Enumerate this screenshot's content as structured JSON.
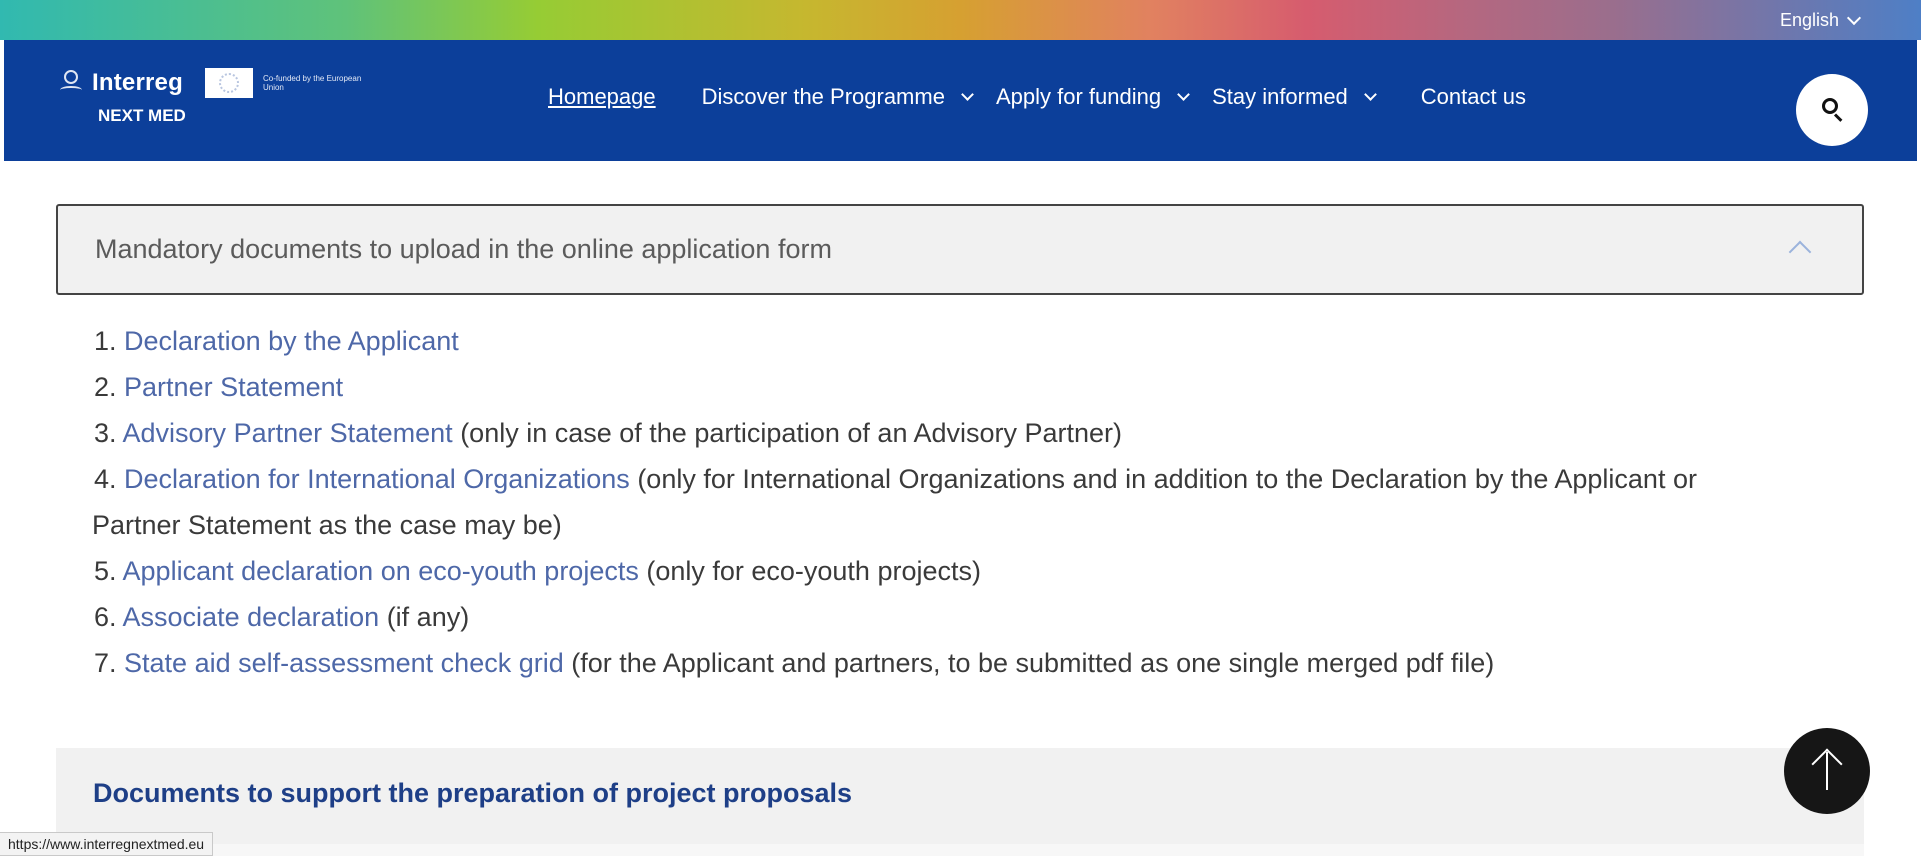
{
  "top_bar": {
    "language": "English"
  },
  "header": {
    "logo": {
      "name": "Interreg",
      "eu_text": "Co-funded by the European Union",
      "subtitle": "NEXT MED"
    },
    "nav": [
      {
        "label": "Homepage",
        "has_dropdown": false
      },
      {
        "label": "Discover the Programme",
        "has_dropdown": true
      },
      {
        "label": "Apply for funding",
        "has_dropdown": true
      },
      {
        "label": "Stay informed",
        "has_dropdown": true
      },
      {
        "label": "Contact us",
        "has_dropdown": false
      }
    ],
    "search_icon": "search-icon"
  },
  "accordion": {
    "title": "Mandatory documents to upload in the online application form",
    "expanded": true,
    "items": [
      {
        "number": "1.",
        "link": "Declaration by the Applicant",
        "note": ""
      },
      {
        "number": "2.",
        "link": "Partner Statement",
        "note": ""
      },
      {
        "number": "3.",
        "link": "Advisory Partner Statement",
        "note": " (only in case of the participation of an Advisory Partner)"
      },
      {
        "number": "4.",
        "link": "Declaration for International Organizations",
        "note": " (only for International Organizations and in addition to the Declaration by the Applicant or",
        "note_cont": "Partner Statement as the case may be)"
      },
      {
        "number": "5.",
        "link": "Applicant declaration on eco-youth projects",
        "note": " (only for eco-youth projects)"
      },
      {
        "number": "6.",
        "link": "Associate declaration",
        "note": " (if any)"
      },
      {
        "number": "7.",
        "link": "State aid self-assessment check grid",
        "note": " (for the Applicant and partners, to be submitted as one single merged pdf file)"
      }
    ]
  },
  "section2": {
    "title": "Documents to support the preparation of project proposals"
  },
  "status_bar": {
    "url": "https://www.interregnextmed.eu"
  },
  "colors": {
    "header_bg": "#0c3f9a",
    "link": "#4e68a8",
    "section_title": "#1e3f87"
  }
}
